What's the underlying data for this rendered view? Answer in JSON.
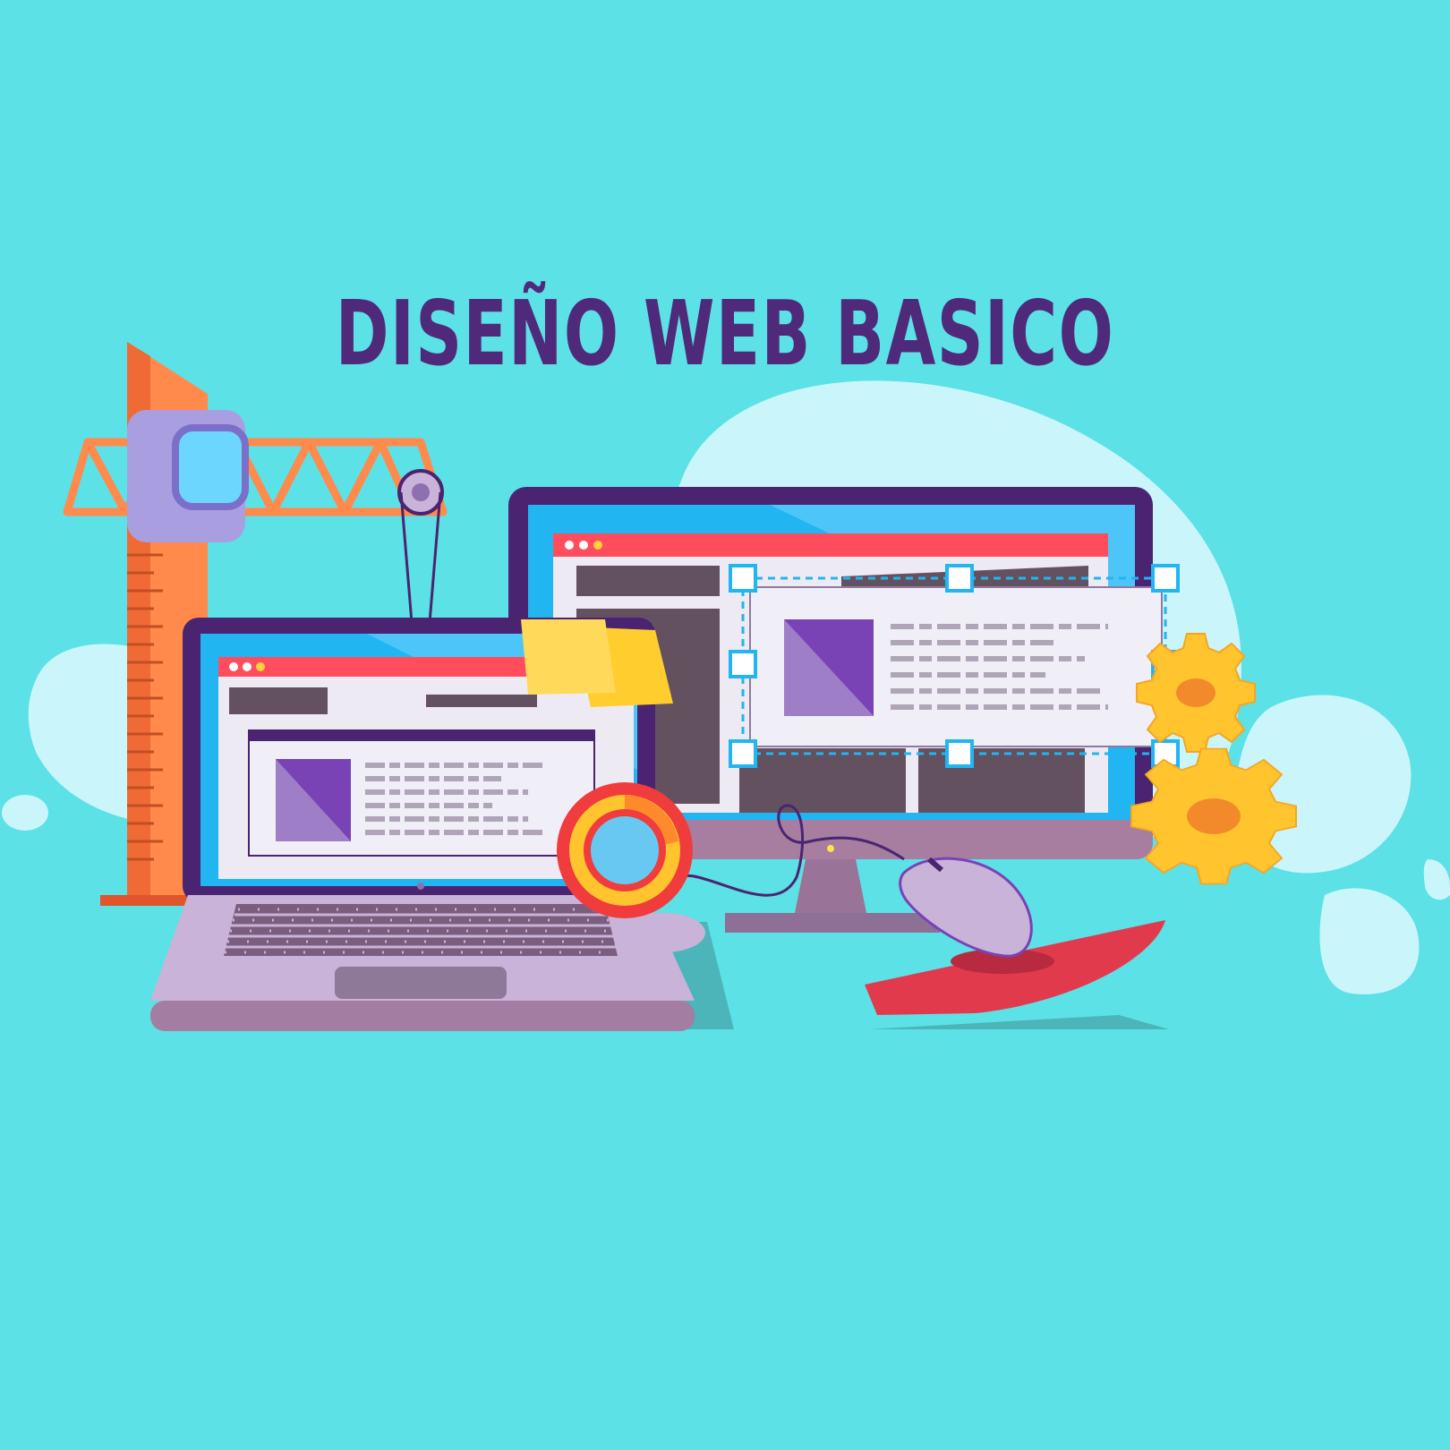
{
  "poster": {
    "title": "DISEÑO WEB BASICO"
  },
  "colors": {
    "background": "#5ce1e6",
    "title": "#4f2a7a",
    "blob": "#c9f5fb",
    "crane": "#ff8a4c",
    "screen_frame": "#4a2470",
    "screen_blue": "#21b5f2",
    "browser_bar": "#ff4d5e",
    "content_purple": "#7a43b5",
    "gear": "#ffc42e",
    "mousepad": "#e23a4d",
    "laptop_body": "#c9b3d8"
  },
  "icons": [
    "crane-illustration",
    "laptop-illustration",
    "monitor-illustration",
    "mouse-illustration",
    "gear-icon",
    "gear-icon",
    "lifebuoy-icon",
    "sticky-note-icon",
    "hook-icon"
  ]
}
